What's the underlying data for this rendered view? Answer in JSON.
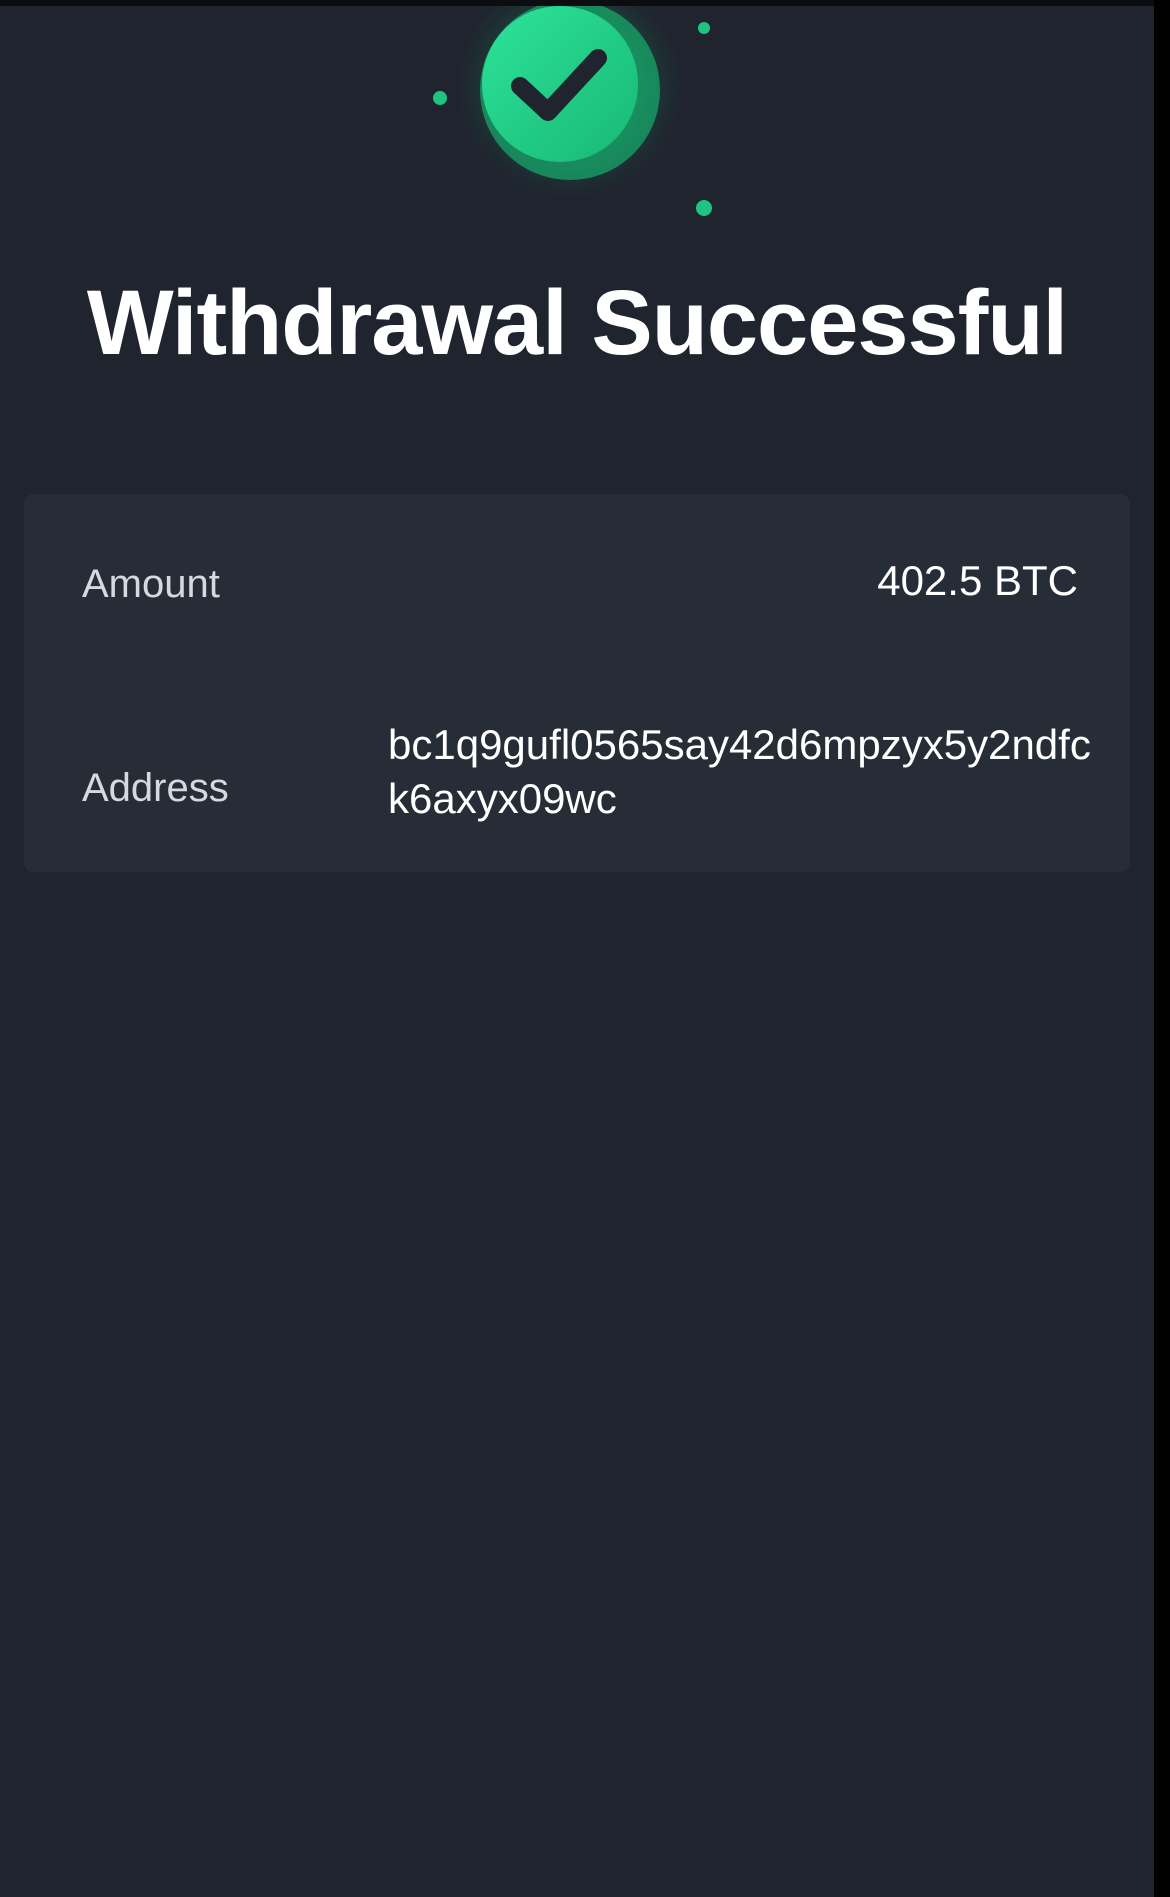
{
  "status": {
    "title": "Withdrawal Successful",
    "icon": "check-circle-icon",
    "accent_color": "#1ec47f"
  },
  "details": {
    "amount_label": "Amount",
    "amount_value": "402.5 BTC",
    "address_label": "Address",
    "address_value": "bc1q9gufl0565say42d6mpzyx5y2ndfck6axyx09wc"
  },
  "colors": {
    "background": "#1f242e",
    "card": "#272d37",
    "text_primary": "#ffffff",
    "text_secondary": "#d6d9de"
  }
}
